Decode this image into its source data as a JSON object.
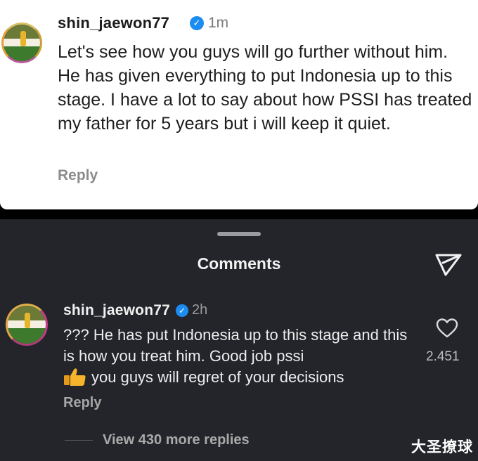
{
  "top_comment": {
    "username": "shin_jaewon77",
    "time": "1m",
    "text": "Let's see how you guys will go further without him. He has given everything to put Indonesia up to this stage. I have a lot to say about how PSSI has treated my father for 5 years but i will keep it quiet.",
    "reply_label": "Reply"
  },
  "comments_sheet": {
    "title": "Comments",
    "send_icon": "send-icon",
    "comment": {
      "username": "shin_jaewon77",
      "time": "2h",
      "text_line": "??? He has put Indonesia up to this stage and this is how you treat him. Good job pssi",
      "text_after_emoji": "you guys will regret of your decisions",
      "reply_label": "Reply",
      "like_count": "2.451",
      "more_replies_label": "View 430 more replies"
    }
  },
  "watermark": "大圣撩球",
  "colors": {
    "verified_blue": "#1d8cf0",
    "sheet_bg": "#23252b",
    "card_bg": "#ffffff"
  }
}
